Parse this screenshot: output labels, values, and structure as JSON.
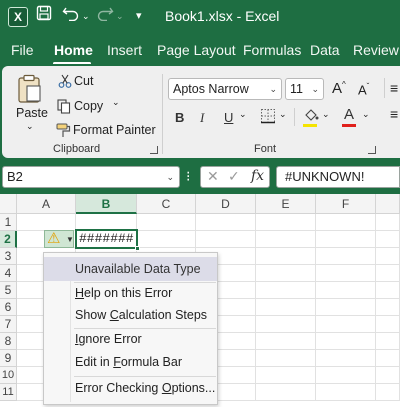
{
  "app": {
    "title": "Book1.xlsx  -  Excel",
    "logo_letter": "X"
  },
  "titlebar": {
    "icons": [
      "save-icon",
      "undo-icon",
      "redo-icon",
      "customize-qat-icon"
    ]
  },
  "tabs": [
    {
      "label": "File",
      "active": false
    },
    {
      "label": "Home",
      "active": true
    },
    {
      "label": "Insert",
      "active": false
    },
    {
      "label": "Page Layout",
      "active": false
    },
    {
      "label": "Formulas",
      "active": false
    },
    {
      "label": "Data",
      "active": false
    },
    {
      "label": "Review",
      "active": false
    }
  ],
  "ribbon": {
    "clipboard": {
      "paste": "Paste",
      "cut": "Cut",
      "copy": "Copy",
      "format_painter": "Format Painter",
      "group_label": "Clipboard"
    },
    "font": {
      "font_name": "Aptos Narrow",
      "font_size": "11",
      "bold": "B",
      "italic": "I",
      "underline": "U",
      "grow": "A",
      "shrink": "A",
      "font_color_letter": "A",
      "group_label": "Font",
      "highlight_color": "#f5e400",
      "font_color": "#e0201b"
    }
  },
  "formula_bar": {
    "name_box": "B2",
    "fx": "fx",
    "value": "#UNKNOWN!"
  },
  "grid": {
    "columns": [
      "A",
      "B",
      "C",
      "D",
      "E",
      "F"
    ],
    "rows": [
      "1",
      "2",
      "3",
      "4",
      "5",
      "6",
      "7",
      "8",
      "9",
      "10",
      "11"
    ],
    "selected_column": "B",
    "selected_row": "2",
    "active_cell_display": "#######"
  },
  "context_menu": {
    "items": [
      {
        "label": "Unavailable Data Type",
        "highlighted": true
      },
      {
        "label": "Help on this Error"
      },
      {
        "label": "Show Calculation Steps"
      },
      {
        "label": "Ignore Error"
      },
      {
        "label": "Edit in Formula Bar"
      },
      {
        "label": "Error Checking Options..."
      }
    ]
  },
  "colors": {
    "excel_green": "#1e6e42",
    "selection_green": "#1e7145"
  }
}
